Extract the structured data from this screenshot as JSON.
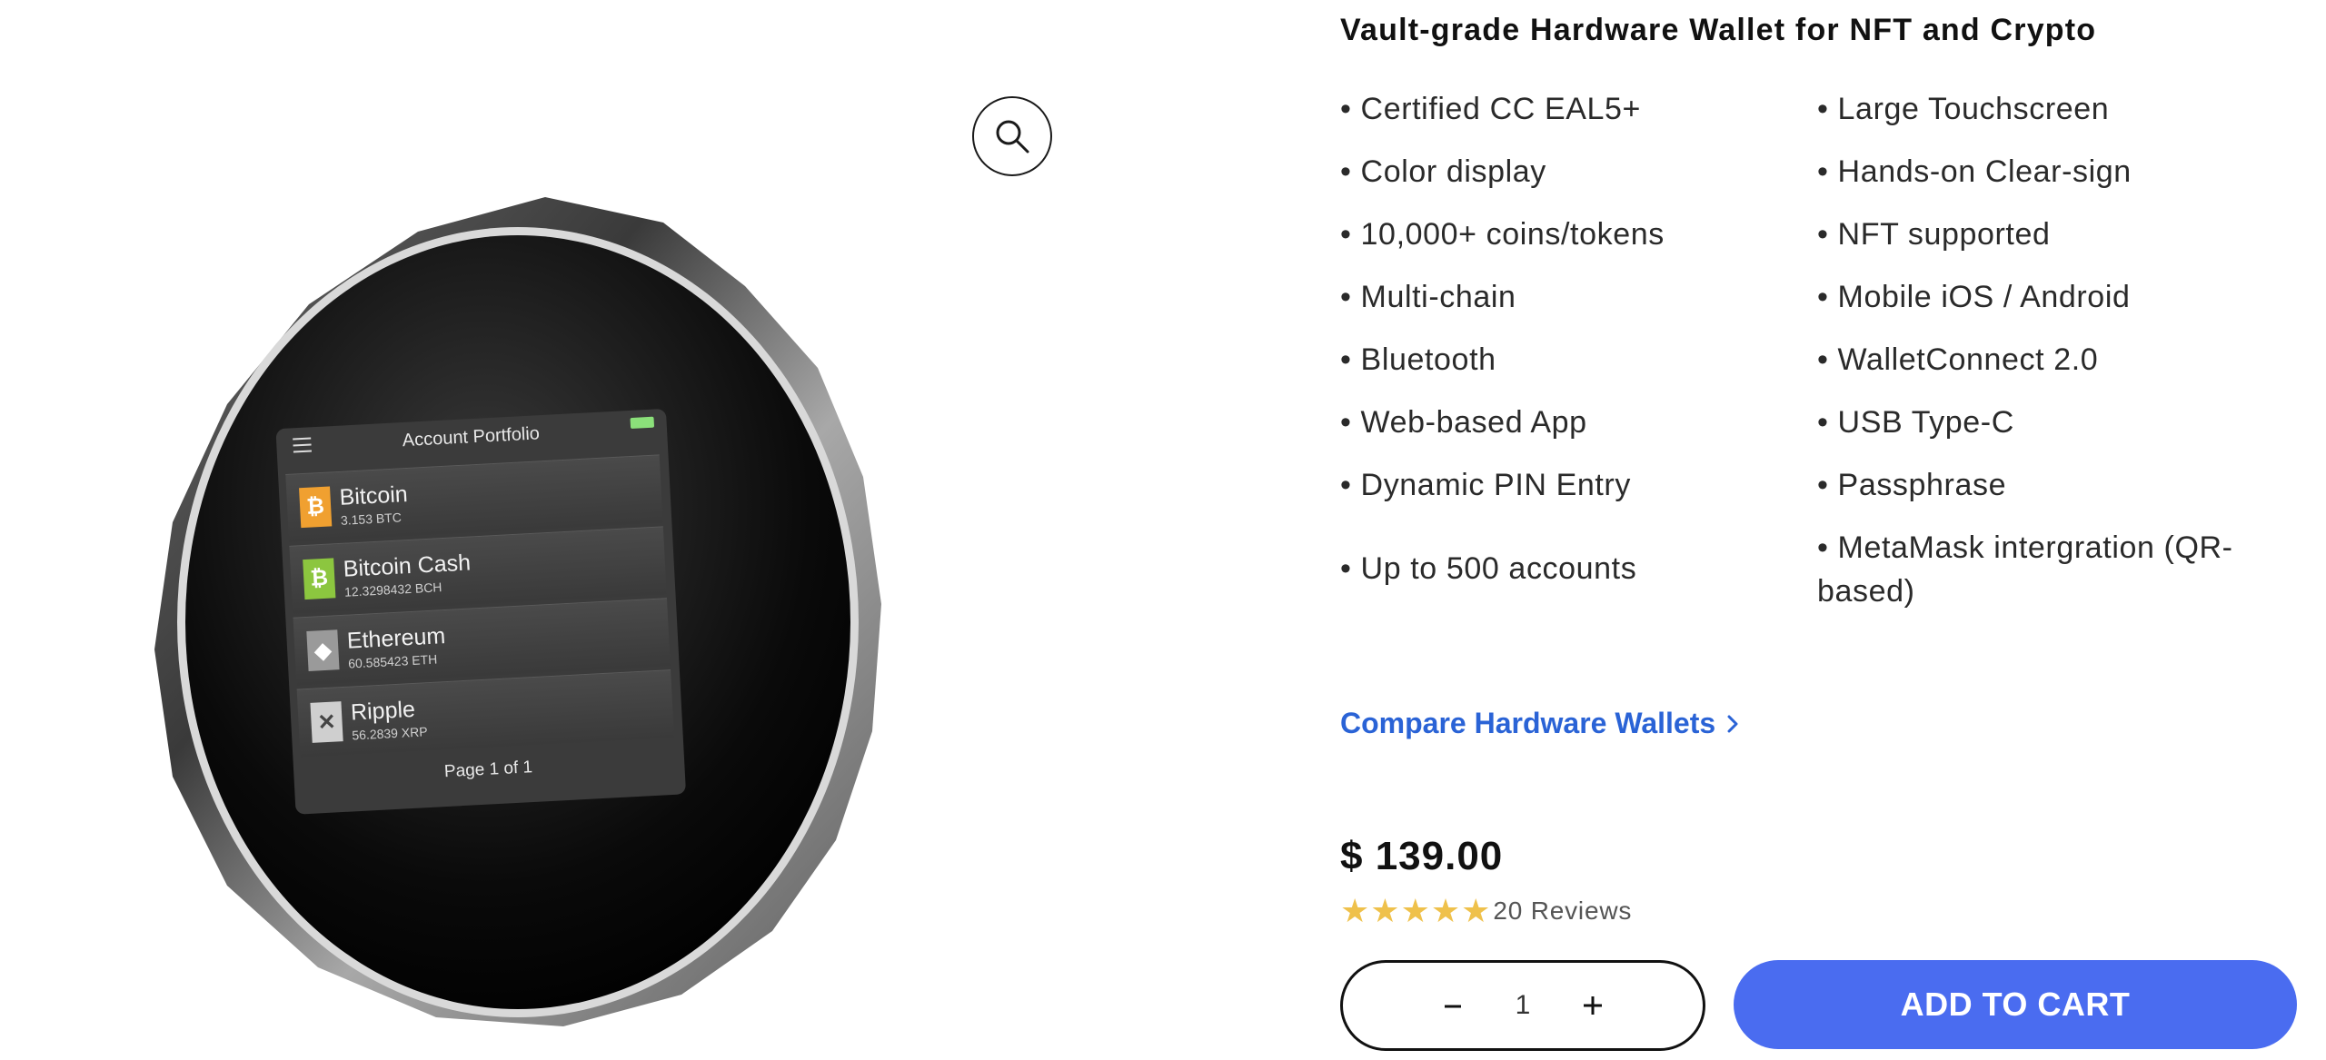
{
  "product": {
    "title": "Vault-grade Hardware Wallet for NFT and Crypto",
    "features_left": [
      "• Certified CC EAL5+",
      "• Color display",
      "• 10,000+ coins/tokens",
      "• Multi-chain",
      "• Bluetooth",
      "• Web-based App",
      "• Dynamic PIN Entry",
      "• Up to 500 accounts"
    ],
    "features_right": [
      "• Large Touchscreen",
      "• Hands-on Clear-sign",
      "• NFT supported",
      "• Mobile iOS / Android",
      "• WalletConnect 2.0",
      "• USB Type-C",
      "• Passphrase",
      "• MetaMask intergration (QR-",
      "based)"
    ],
    "compare_link": "Compare Hardware Wallets",
    "price": "$ 139.00",
    "rating": 5,
    "reviews": "20 Reviews",
    "quantity": "1",
    "add_to_cart": "ADD TO CART"
  },
  "device_screen": {
    "header": "Account Portfolio",
    "coins": [
      {
        "name": "Bitcoin",
        "amount": "3.153 BTC",
        "icon": "bitcoin-icon",
        "color": "#f0a030"
      },
      {
        "name": "Bitcoin Cash",
        "amount": "12.3298432 BCH",
        "icon": "bitcoin-cash-icon",
        "color": "#8cc63f"
      },
      {
        "name": "Ethereum",
        "amount": "60.585423 ETH",
        "icon": "ethereum-icon",
        "color": "#9a9a9a"
      },
      {
        "name": "Ripple",
        "amount": "56.2839 XRP",
        "icon": "ripple-icon",
        "color": "#cfcfcf"
      }
    ],
    "page_indicator": "Page 1 of 1"
  },
  "colors": {
    "accent": "#4a6cf0",
    "link": "#2a63d6",
    "star": "#efc14b"
  },
  "icons": {
    "zoom": "magnifier-icon",
    "compare_chevron": "chevron-right-icon",
    "minus": "minus-icon",
    "plus": "plus-icon"
  }
}
